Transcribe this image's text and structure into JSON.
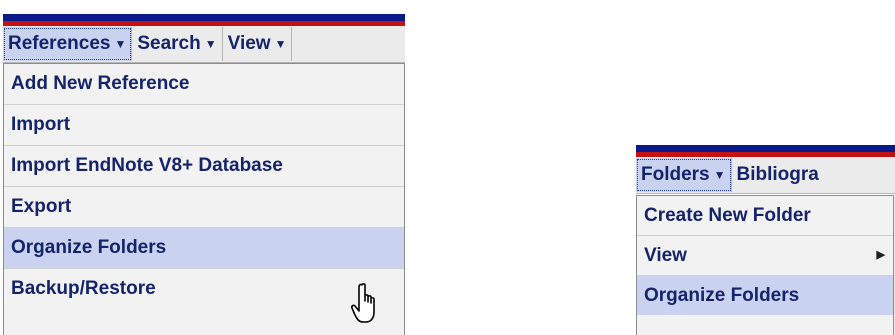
{
  "left_panel": {
    "menubar": {
      "menus": [
        {
          "label": "References",
          "caret": "▼"
        },
        {
          "label": "Search",
          "caret": "▼"
        },
        {
          "label": "View",
          "caret": "▼"
        }
      ]
    },
    "dropdown": {
      "items": [
        {
          "label": "Add New Reference"
        },
        {
          "label": "Import"
        },
        {
          "label": "Import EndNote V8+ Database"
        },
        {
          "label": "Export"
        },
        {
          "label": "Organize Folders"
        },
        {
          "label": "Backup/Restore"
        }
      ]
    }
  },
  "right_panel": {
    "menubar": {
      "menus": [
        {
          "label": "Folders",
          "caret": "▼"
        },
        {
          "label": "Bibliogra"
        }
      ]
    },
    "dropdown": {
      "items": [
        {
          "label": "Create New Folder"
        },
        {
          "label": "View",
          "submenu_arrow": "▶"
        },
        {
          "label": "Organize Folders"
        }
      ]
    }
  },
  "colors": {
    "stripe_blue": "#0b1a8a",
    "stripe_red": "#c41212",
    "menu_text": "#14246a",
    "highlight": "#c9d3ef",
    "menu_bg": "#ebebeb",
    "dropdown_bg": "#f2f2f2"
  },
  "icons": {
    "cursor": "hand-pointer-icon",
    "caret": "caret-down-icon",
    "submenu": "caret-right-icon"
  }
}
